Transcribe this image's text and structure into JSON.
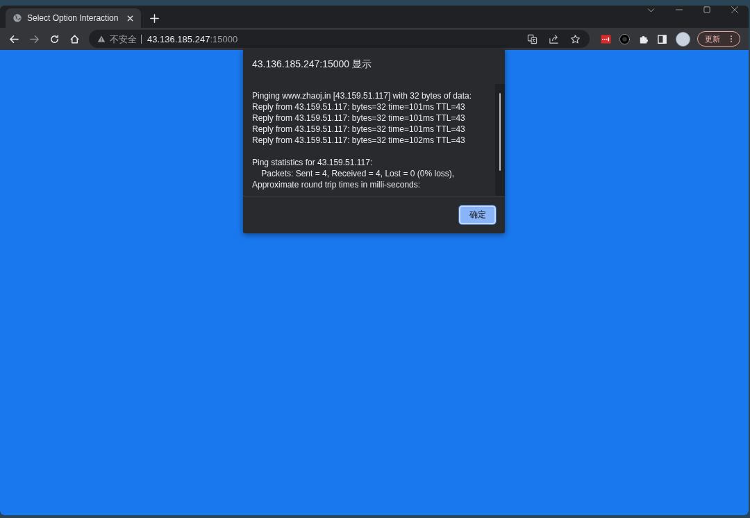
{
  "tab": {
    "title": "Select Option Interaction",
    "selected": true
  },
  "toolbar": {
    "forward_disabled": true,
    "security_label": "不安全",
    "url_host": "43.136.185.247",
    "url_port": ":15000",
    "update_button": "更新"
  },
  "dialog": {
    "title": "43.136.185.247:15000 显示",
    "paragraphs": [
      [
        "Pinging www.zhaoj.in [43.159.51.117] with 32 bytes of data:",
        "Reply from 43.159.51.117: bytes=32 time=101ms TTL=43",
        "Reply from 43.159.51.117: bytes=32 time=101ms TTL=43",
        "Reply from 43.159.51.117: bytes=32 time=101ms TTL=43",
        "Reply from 43.159.51.117: bytes=32 time=102ms TTL=43"
      ],
      [
        "Ping statistics for 43.159.51.117:",
        "    Packets: Sent = 4, Received = 4, Lost = 0 (0% loss),",
        "Approximate round trip times in milli-seconds:"
      ]
    ],
    "ok_button": "确定"
  }
}
